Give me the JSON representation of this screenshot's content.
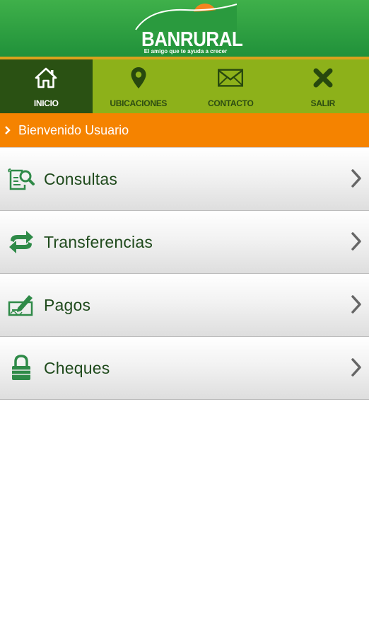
{
  "brand": {
    "name": "BANRURAL",
    "tagline": "El amigo que te ayuda a crecer",
    "icon": "sun-over-hills-logo"
  },
  "nav": {
    "items": [
      {
        "label": "INICIO",
        "icon": "home-icon",
        "active": true
      },
      {
        "label": "UBICACIONES",
        "icon": "map-pin-icon",
        "active": false
      },
      {
        "label": "CONTACTO",
        "icon": "envelope-icon",
        "active": false
      },
      {
        "label": "SALIR",
        "icon": "close-icon",
        "active": false
      }
    ]
  },
  "welcome": {
    "text": "Bienvenido Usuario"
  },
  "menu": {
    "items": [
      {
        "label": "Consultas",
        "icon": "document-search-icon"
      },
      {
        "label": "Transferencias",
        "icon": "transfer-arrows-icon"
      },
      {
        "label": "Pagos",
        "icon": "check-sign-icon"
      },
      {
        "label": "Cheques",
        "icon": "lock-icon"
      }
    ]
  },
  "colors": {
    "header_green": "#2fa343",
    "nav_green": "#8db11a",
    "nav_active": "#2a5113",
    "welcome_orange": "#f58300",
    "menu_text": "#1f4a1c",
    "icon_green": "#2f8a48"
  }
}
